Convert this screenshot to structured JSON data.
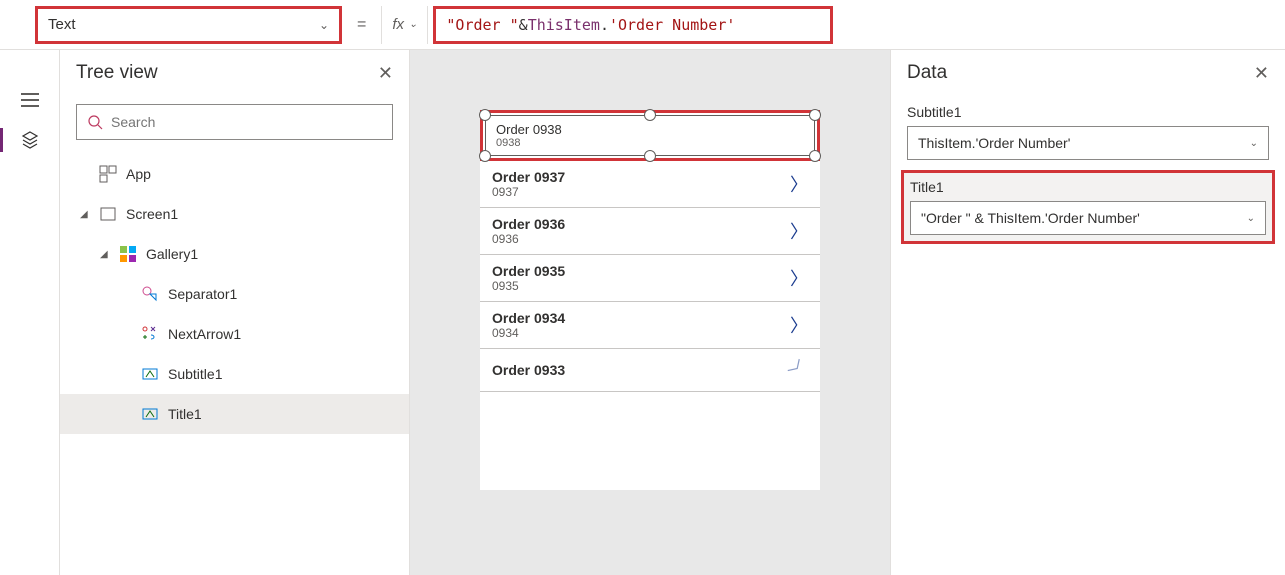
{
  "formulaBar": {
    "property": "Text",
    "fx": "fx",
    "formula_str": "\"Order \"",
    "formula_op": " & ",
    "formula_obj": "ThisItem",
    "formula_dot": ".",
    "formula_prop": "'Order Number'"
  },
  "treeView": {
    "title": "Tree view",
    "searchPlaceholder": "Search",
    "items": {
      "app": "App",
      "screen1": "Screen1",
      "gallery1": "Gallery1",
      "separator1": "Separator1",
      "nextArrow1": "NextArrow1",
      "subtitle1": "Subtitle1",
      "title1": "Title1"
    }
  },
  "gallery": {
    "items": [
      {
        "title": "Order 0938",
        "subtitle": "0938"
      },
      {
        "title": "Order 0937",
        "subtitle": "0937"
      },
      {
        "title": "Order 0936",
        "subtitle": "0936"
      },
      {
        "title": "Order 0935",
        "subtitle": "0935"
      },
      {
        "title": "Order 0934",
        "subtitle": "0934"
      },
      {
        "title": "Order 0933",
        "subtitle": ""
      }
    ]
  },
  "dataPanel": {
    "title": "Data",
    "fields": [
      {
        "label": "Subtitle1",
        "value": "ThisItem.'Order Number'"
      },
      {
        "label": "Title1",
        "value": "\"Order \" & ThisItem.'Order Number'"
      }
    ]
  }
}
